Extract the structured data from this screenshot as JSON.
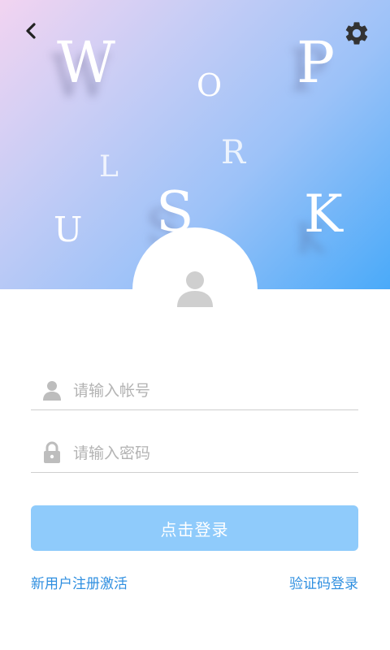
{
  "header": {
    "decorative_letters": [
      "W",
      "O",
      "P",
      "L",
      "R",
      "U",
      "S",
      "K"
    ]
  },
  "icons": {
    "back": "chevron-left-icon",
    "settings": "gear-icon",
    "avatar": "user-icon",
    "account": "user-icon",
    "password": "lock-icon"
  },
  "form": {
    "account_placeholder": "请输入帐号",
    "password_placeholder": "请输入密码",
    "login_label": "点击登录"
  },
  "links": {
    "register": "新用户注册激活",
    "sms_login": "验证码登录"
  },
  "colors": {
    "gradient_start": "#f2d4f1",
    "gradient_end": "#4aaaf9",
    "button": "#8fcbfb",
    "link": "#2f8fe0"
  }
}
